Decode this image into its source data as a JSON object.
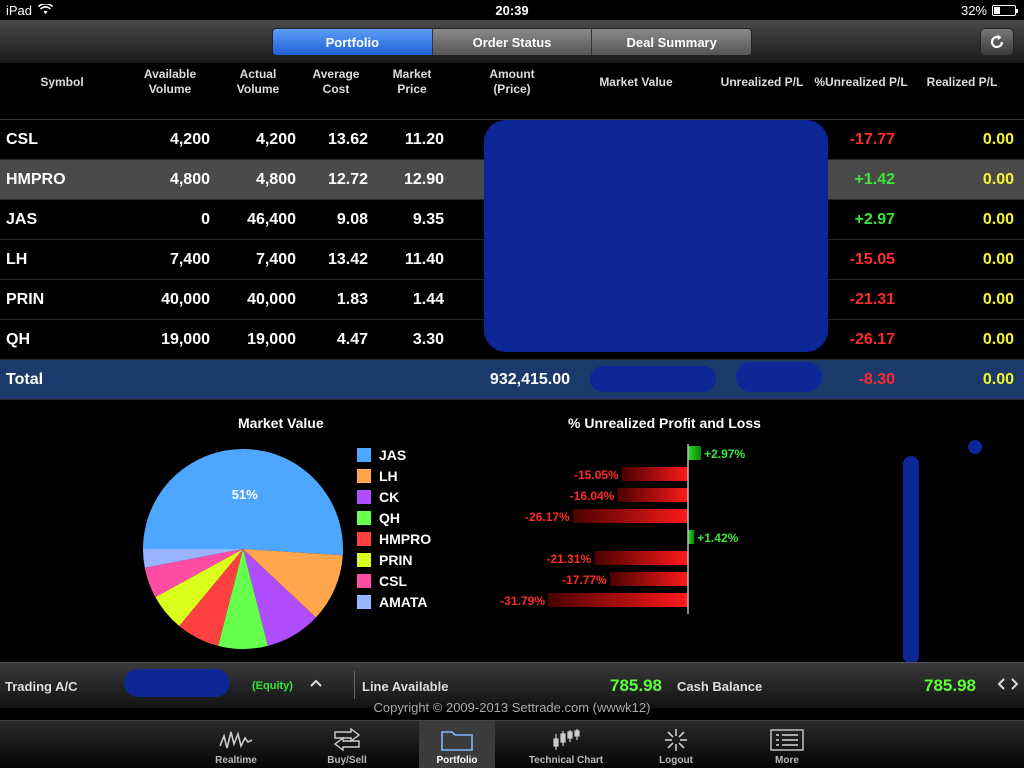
{
  "status": {
    "device": "iPad",
    "time": "20:39",
    "battery": "32%",
    "battery_level": 0.32
  },
  "nav": {
    "tabs": [
      {
        "label": "Portfolio",
        "active": true
      },
      {
        "label": "Order Status",
        "active": false
      },
      {
        "label": "Deal Summary",
        "active": false
      }
    ]
  },
  "table": {
    "headers": {
      "symbol": "Symbol",
      "avail_1": "Available",
      "avail_2": "Volume",
      "actual_1": "Actual",
      "actual_2": "Volume",
      "avgcost_1": "Average",
      "avgcost_2": "Cost",
      "mktprice_1": "Market",
      "mktprice_2": "Price",
      "amount_1": "Amount",
      "amount_2": "(Price)",
      "market_value": "Market Value",
      "unrealized": "Unrealized P/L",
      "pct_unrealized": "%Unrealized P/L",
      "realized": "Realized P/L"
    },
    "rows": [
      {
        "symbol": "CSL",
        "available": "4,200",
        "actual": "4,200",
        "avg_cost": "13.62",
        "market_price": "11.20",
        "pct": "-17.77",
        "realized": "0.00"
      },
      {
        "symbol": "HMPRO",
        "available": "4,800",
        "actual": "4,800",
        "avg_cost": "12.72",
        "market_price": "12.90",
        "pct": "+1.42",
        "realized": "0.00"
      },
      {
        "symbol": "JAS",
        "available": "0",
        "actual": "46,400",
        "avg_cost": "9.08",
        "market_price": "9.35",
        "pct": "+2.97",
        "realized": "0.00"
      },
      {
        "symbol": "LH",
        "available": "7,400",
        "actual": "7,400",
        "avg_cost": "13.42",
        "market_price": "11.40",
        "pct": "-15.05",
        "realized": "0.00"
      },
      {
        "symbol": "PRIN",
        "available": "40,000",
        "actual": "40,000",
        "avg_cost": "1.83",
        "market_price": "1.44",
        "pct": "-21.31",
        "realized": "0.00"
      },
      {
        "symbol": "QH",
        "available": "19,000",
        "actual": "19,000",
        "avg_cost": "4.47",
        "market_price": "3.30",
        "pct": "-26.17",
        "realized": "0.00"
      }
    ],
    "total": {
      "label": "Total",
      "amount": "932,415.00",
      "pct": "-8.30",
      "realized": "0.00"
    }
  },
  "charts": {
    "pie_title": "Market Value",
    "bar_title": "% Unrealized Profit and Loss"
  },
  "chart_data": [
    {
      "type": "pie",
      "title": "Market Value",
      "labels": [
        "JAS",
        "LH",
        "CK",
        "QH",
        "HMPRO",
        "PRIN",
        "CSL",
        "AMATA"
      ],
      "values": [
        51,
        11,
        9,
        8,
        7,
        6,
        5,
        3
      ],
      "slice_labels": [
        "51%",
        "",
        "",
        "",
        "",
        "",
        "",
        ""
      ],
      "colors": [
        "#4da6ff",
        "#ffa64d",
        "#b04dff",
        "#66ff4d",
        "#ff4040",
        "#d9ff1a",
        "#ff4da6",
        "#99b3ff"
      ]
    },
    {
      "type": "bar",
      "title": "% Unrealized Profit and Loss",
      "categories": [
        "JAS",
        "LH",
        "CK",
        "QH",
        "HMPRO",
        "PRIN",
        "CSL",
        "AMATA"
      ],
      "values": [
        2.97,
        -15.05,
        -16.04,
        -26.17,
        1.42,
        -21.31,
        -17.77,
        -31.79
      ],
      "labels": [
        "+2.97%",
        "-15.05%",
        "-16.04%",
        "-26.17%",
        "+1.42%",
        "-21.31%",
        "-17.77%",
        "-31.79%"
      ]
    }
  ],
  "info": {
    "trading_label": "Trading A/C",
    "account_type": "(Equity)",
    "line_label": "Line Available",
    "line_value": "785.98",
    "cash_label": "Cash Balance",
    "cash_value": "785.98"
  },
  "copyright": "Copyright © 2009-2013 Settrade.com (wwwk12)",
  "tabbar": [
    {
      "label": "Realtime",
      "icon": "realtime-icon"
    },
    {
      "label": "Buy/Sell",
      "icon": "buy-sell-icon"
    },
    {
      "label": "Portfolio",
      "icon": "folder-icon",
      "active": true
    },
    {
      "label": "Technical Chart",
      "icon": "candlestick-icon"
    },
    {
      "label": "Logout",
      "icon": "logout-icon"
    },
    {
      "label": "More",
      "icon": "list-icon"
    }
  ]
}
